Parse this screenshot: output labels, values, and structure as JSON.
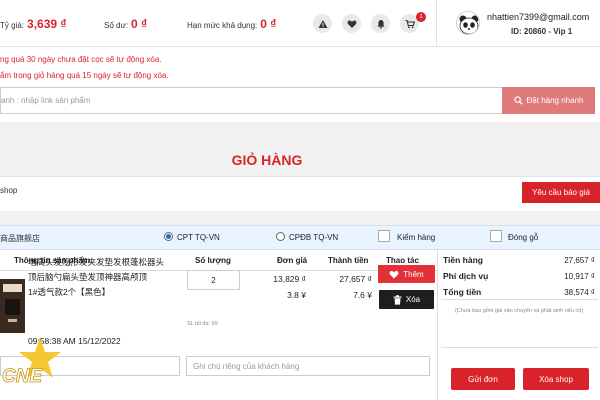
{
  "header": {
    "rate_label": "Tỷ giá:",
    "rate_value": "3,639 ₫",
    "balance_label": "Số dư:",
    "balance_value": "0 ₫",
    "limit_label": "Hạn mức khả dụng:",
    "limit_value": "0 ₫",
    "cart_count": "1",
    "user_email": "nhattien7399@gmail.com",
    "user_id": "ID: 20860 - Vip 1"
  },
  "notes": [
    "ng quá 30 ngày chưa đặt cọc sẽ tự động xóa.",
    "ẩm trong giỏ hàng quá 15 ngày sẽ tự động xóa."
  ],
  "search": {
    "placeholder": "anh : nhập link sản phẩm",
    "button_label": "Đặt hàng nhanh"
  },
  "cart_title": "GIỎ HÀNG",
  "shop": {
    "label": "shop",
    "quote_button": "Yêu cầu báo giá",
    "store_name": "商品旗舰店",
    "option_1": "CPT TQ-VN",
    "option_2": "CPĐB TQ-VN",
    "check_1": "Kiểm hàng",
    "check_2": "Đóng gỗ"
  },
  "table": {
    "headers": [
      "Thông tin sản phẩm",
      "Số lượng",
      "Đơn giá",
      "Thành tiền",
      "Thao tác"
    ],
    "product_lines": [
      "増高头发隐形发夹发垫发根蓬松器头",
      "顶后脑勺扁头垫发顶神器高颅顶",
      "1#透气款2个【黑色】"
    ],
    "product_time": "09:58:38 AM 15/12/2022",
    "quantity": "2",
    "qty_note": "SL tối đa: 99",
    "unit_price_vnd": "13,829 ₫",
    "unit_price_cny": "3.8 ¥",
    "total_vnd": "27,657 ₫",
    "total_cny": "7.6 ¥",
    "add_button": "Thêm",
    "delete_button": "Xóa",
    "note_placeholder_1": "",
    "note_placeholder_2": "Ghi chú riêng của khách hàng"
  },
  "summary": {
    "goods_label": "Tiền hàng",
    "goods_value": "27,657 ₫",
    "service_label": "Phí dịch vụ",
    "service_value": "10,917 ₫",
    "total_label": "Tổng tiền",
    "total_value": "38,574 ₫",
    "note": "(Chưa bao gồm giá vận chuyển và phát sinh nếu có)",
    "send_button": "Gửi đơn",
    "delete_shop_button": "Xóa shop"
  },
  "watermark": "CNE",
  "colors": {
    "accent": "#d9232a",
    "store_row": "#e9f3ff",
    "dark_button": "#1e1e1e"
  }
}
